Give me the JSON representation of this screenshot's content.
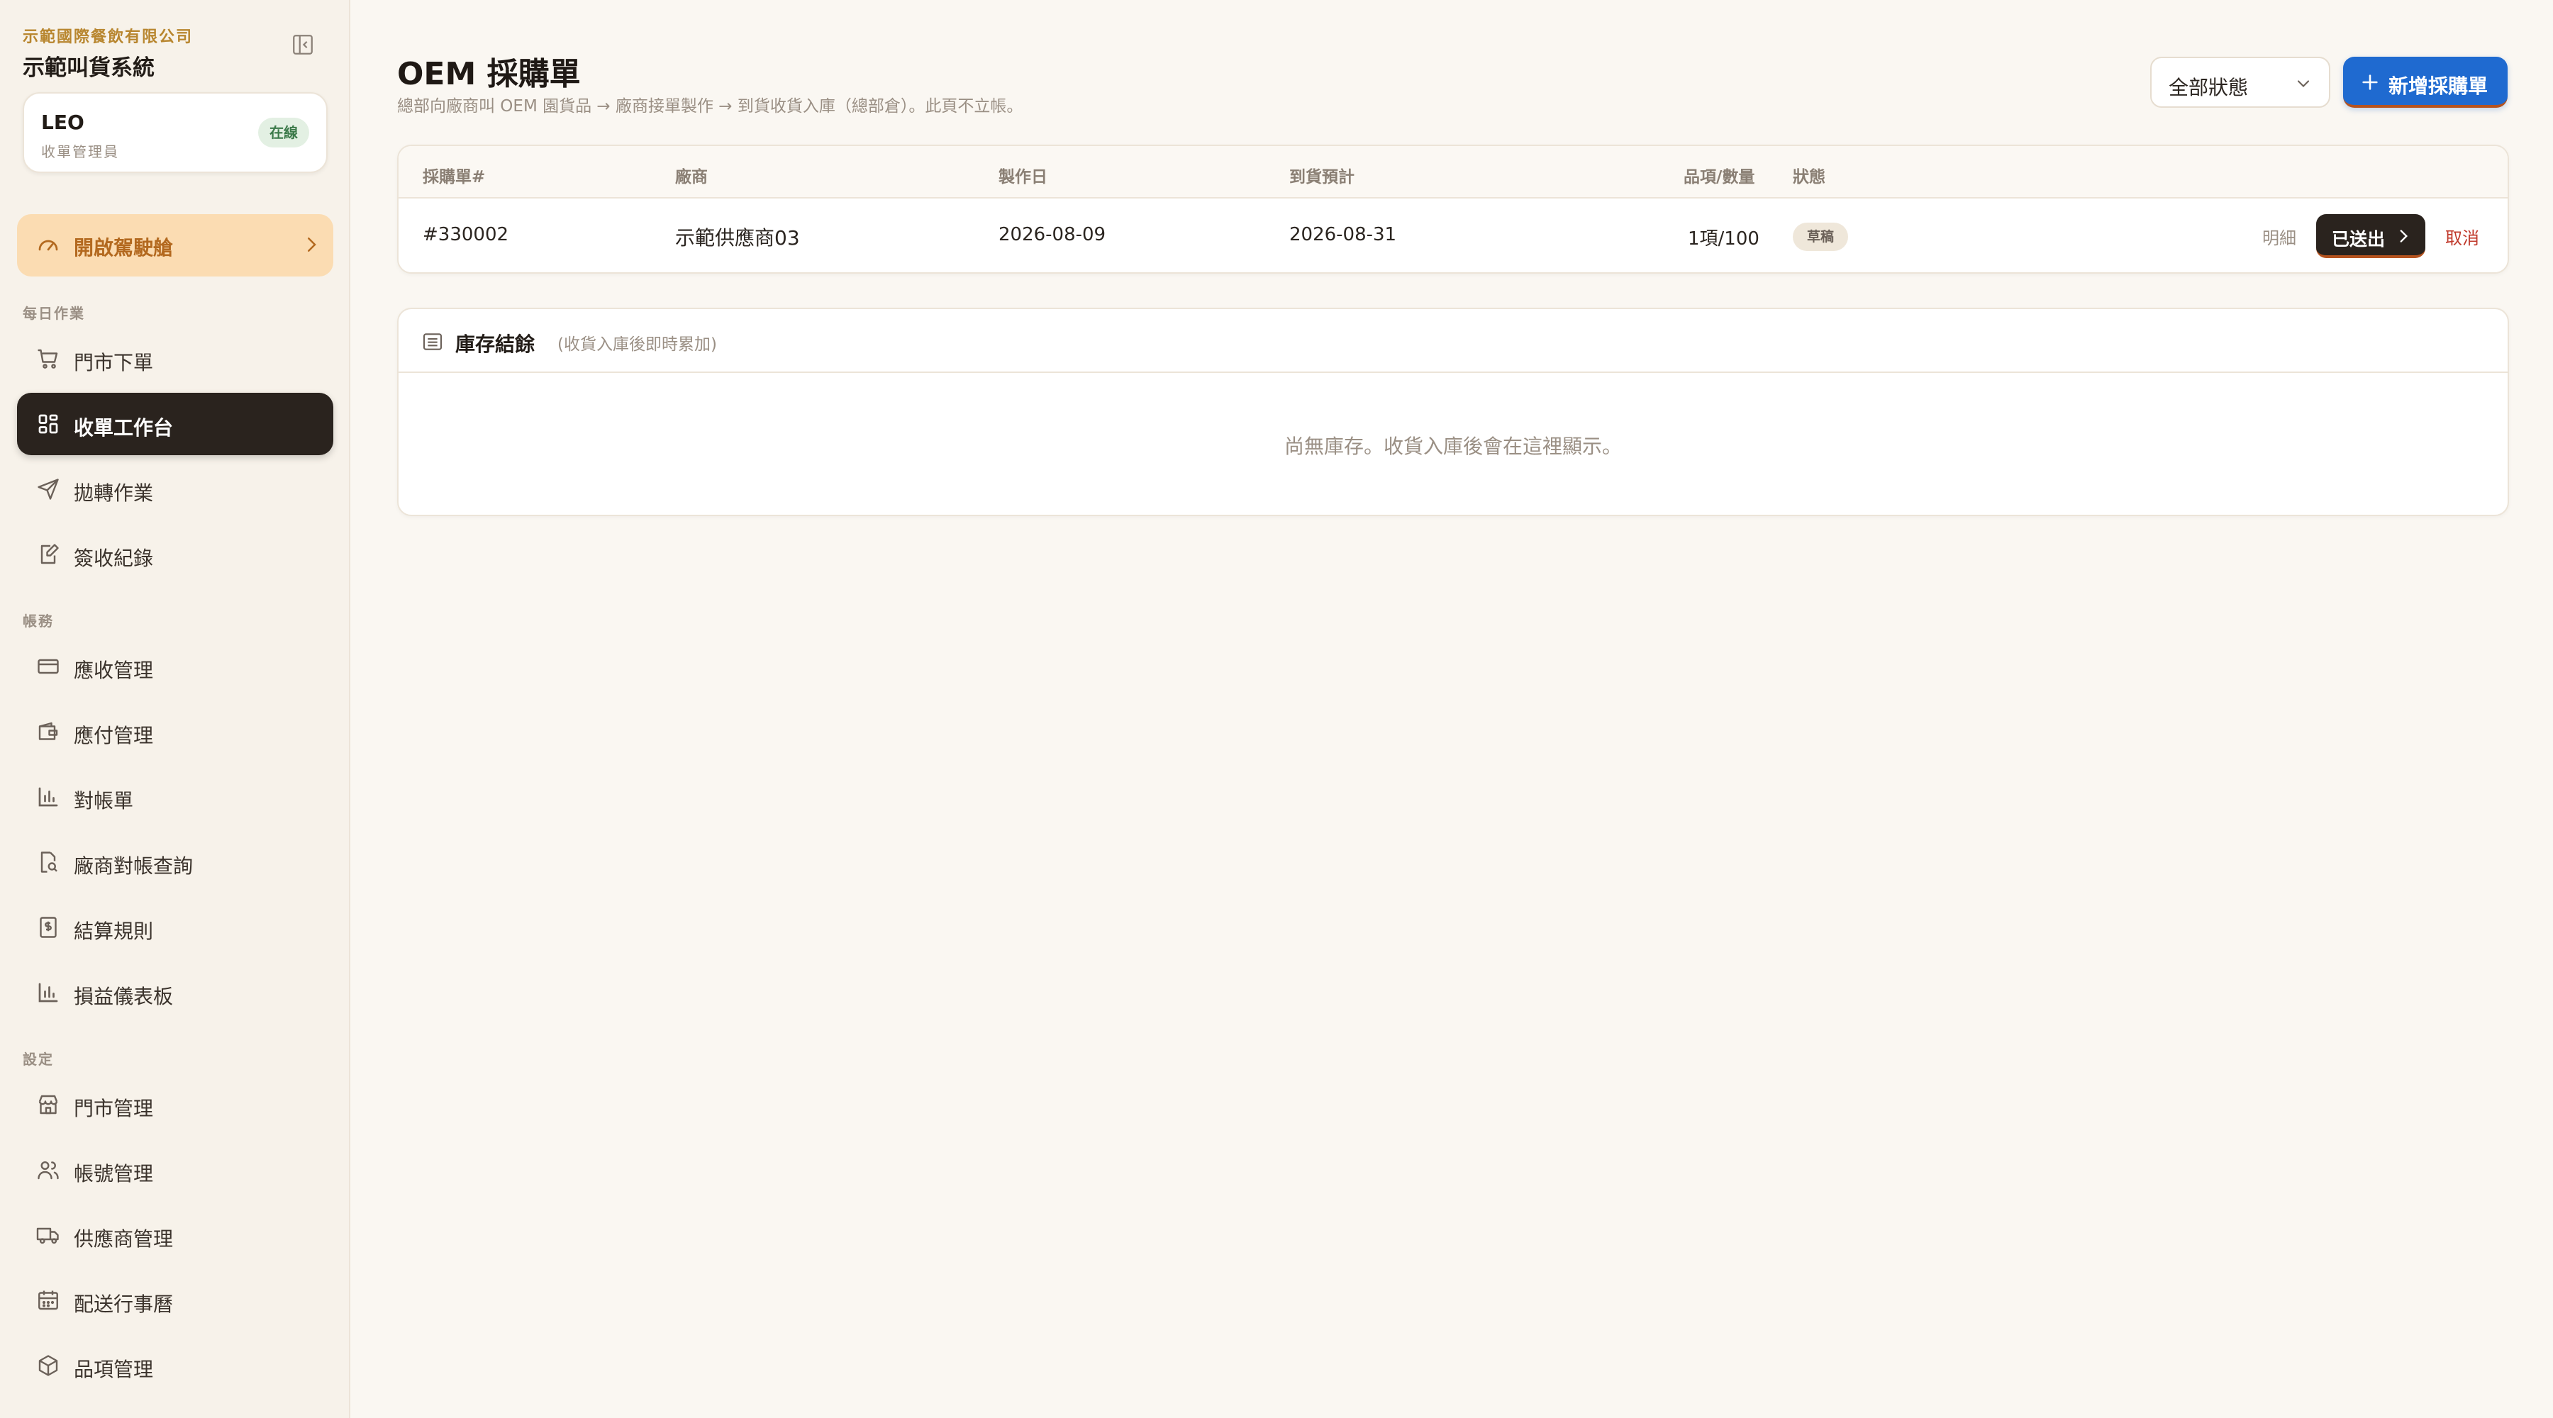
{
  "sidebar": {
    "company": "示範國際餐飲有限公司",
    "system_name": "示範叫貨系統",
    "user": {
      "name": "LEO",
      "role": "收單管理員",
      "status": "在線"
    },
    "cockpit_label": "開啟駕駛艙",
    "sections": {
      "daily": "每日作業",
      "accounting": "帳務",
      "settings": "設定"
    },
    "items": [
      {
        "label": "門市下單",
        "icon": "cart-icon"
      },
      {
        "label": "收單工作台",
        "icon": "grid-icon",
        "active": true
      },
      {
        "label": "拋轉作業",
        "icon": "send-icon"
      },
      {
        "label": "簽收紀錄",
        "icon": "edit-doc-icon"
      },
      {
        "label": "應收管理",
        "icon": "card-icon"
      },
      {
        "label": "應付管理",
        "icon": "wallet-icon"
      },
      {
        "label": "對帳單",
        "icon": "bar-chart-icon"
      },
      {
        "label": "廠商對帳查詢",
        "icon": "doc-search-icon"
      },
      {
        "label": "結算規則",
        "icon": "dollar-doc-icon"
      },
      {
        "label": "損益儀表板",
        "icon": "bar-chart-icon"
      },
      {
        "label": "門市管理",
        "icon": "store-icon"
      },
      {
        "label": "帳號管理",
        "icon": "users-icon"
      },
      {
        "label": "供應商管理",
        "icon": "truck-icon"
      },
      {
        "label": "配送行事曆",
        "icon": "calendar-icon"
      },
      {
        "label": "品項管理",
        "icon": "box-icon"
      }
    ]
  },
  "header": {
    "title": "OEM 採購單",
    "subtitle": "總部向廠商叫 OEM 園貨品 → 廠商接單製作 → 到貨收貨入庫（總部倉）。此頁不立帳。",
    "status_filter": "全部狀態",
    "new_button": "新增採購單"
  },
  "po_table": {
    "columns": [
      "採購單#",
      "廠商",
      "製作日",
      "到貨預計",
      "品項/數量",
      "狀態"
    ],
    "rows": [
      {
        "po_no": "#330002",
        "vendor": "示範供應商03",
        "make_date": "2026-08-09",
        "eta": "2026-08-31",
        "qty": "1項/100",
        "status": "草稿",
        "detail": "明細",
        "sent": "已送出",
        "cancel": "取消"
      }
    ]
  },
  "inventory": {
    "title": "庫存結餘",
    "hint": "(收貨入庫後即時累加)",
    "empty": "尚無庫存。收貨入庫後會在這裡顯示。"
  },
  "colors": {
    "accent_blue": "#1f6ad0",
    "cockpit_bg": "#fbdcb2",
    "active_nav": "#2a231e",
    "cancel_red": "#c0392b"
  }
}
